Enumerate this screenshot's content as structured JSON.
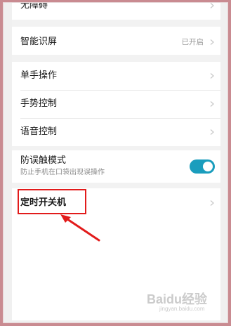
{
  "settings": {
    "accessibility": {
      "label": "无障碍"
    },
    "smart_screen": {
      "label": "智能识屏",
      "value": "已开启"
    },
    "one_hand": {
      "label": "单手操作"
    },
    "gesture": {
      "label": "手势控制"
    },
    "voice": {
      "label": "语音控制"
    },
    "accidental_touch": {
      "label": "防误触模式",
      "description": "防止手机在口袋出现误操作",
      "enabled": true
    },
    "scheduled_power": {
      "label": "定时开关机"
    }
  },
  "annotation": {
    "box_color": "#e21b1b",
    "arrow_color": "#e21b1b"
  },
  "watermark": {
    "text": "Baidu经验",
    "subtext": "jingyan.baidu.com"
  },
  "colors": {
    "frame": "#c98b91",
    "toggle_on": "#1a9dbd",
    "background": "#f2f2f2"
  }
}
